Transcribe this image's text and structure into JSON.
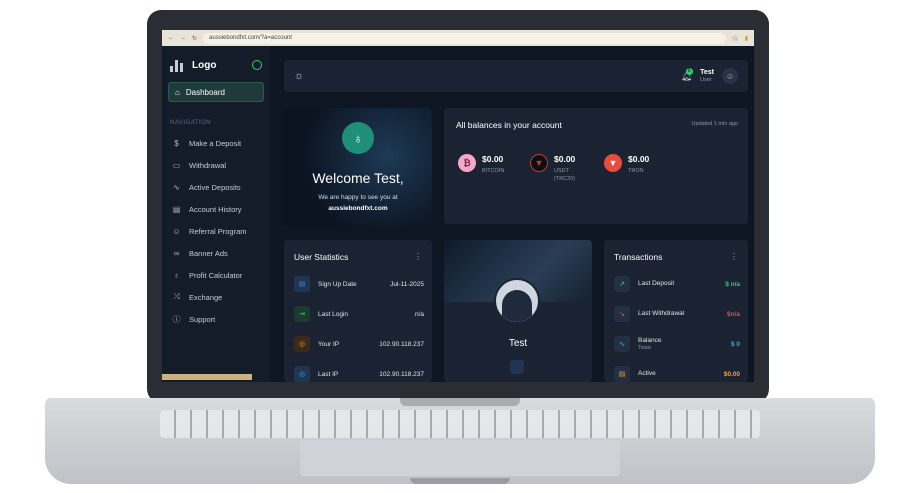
{
  "browser": {
    "url": "aussiebondfxt.com/?a=account"
  },
  "sidebar": {
    "logo": "Logo",
    "active_item": "Dashboard",
    "section_title": "NAVIGATION",
    "items": [
      {
        "label": "Make a Deposit",
        "icon": "dollar-icon"
      },
      {
        "label": "Withdrawal",
        "icon": "wallet-icon"
      },
      {
        "label": "Active Deposits",
        "icon": "activity-icon"
      },
      {
        "label": "Account History",
        "icon": "calendar-icon"
      },
      {
        "label": "Referral Program",
        "icon": "users-icon"
      },
      {
        "label": "Banner Ads",
        "icon": "link-icon"
      },
      {
        "label": "Profit Calculator",
        "icon": "award-icon"
      },
      {
        "label": "Exchange",
        "icon": "shuffle-icon"
      },
      {
        "label": "Support",
        "icon": "info-icon"
      }
    ]
  },
  "topbar": {
    "notification_count": "0",
    "user_name": "Test",
    "user_role": "User"
  },
  "welcome": {
    "title": "Welcome Test,",
    "subtitle": "We are happy to see you at",
    "site": "aussiebondfxt.com"
  },
  "balances": {
    "title": "All balances in your account",
    "updated": "Updated 1 min ago",
    "coins": [
      {
        "amount": "$0.00",
        "name": "BITCOIN",
        "color": "#f4a7c8"
      },
      {
        "amount": "$0.00",
        "name": "USDT",
        "name2": "(TRC20)",
        "color": "#c0392b"
      },
      {
        "amount": "$0.00",
        "name": "TRON",
        "color": "#e74c3c"
      }
    ]
  },
  "stats": {
    "title": "User Statistics",
    "rows": [
      {
        "label": "Sign Up Date",
        "value": "Jul-11-2025"
      },
      {
        "label": "Last Login",
        "value": "n/a"
      },
      {
        "label": "Your IP",
        "value": "102.90.118.237"
      },
      {
        "label": "Last IP",
        "value": "102.90.118.237"
      }
    ]
  },
  "profile": {
    "name": "Test"
  },
  "transactions": {
    "title": "Transactions",
    "rows": [
      {
        "label": "Last Deposit",
        "sub": "",
        "value": "$ n/a",
        "color": "#2ecc71"
      },
      {
        "label": "Last Withdrawal",
        "sub": "",
        "value": "$n/a",
        "color": "#e74c3c"
      },
      {
        "label": "Balance",
        "sub": "Totals",
        "value": "$ 0",
        "color": "#3aa8e0"
      },
      {
        "label": "Active",
        "sub": "",
        "value": "$0.00",
        "color": "#f0a030"
      }
    ]
  }
}
